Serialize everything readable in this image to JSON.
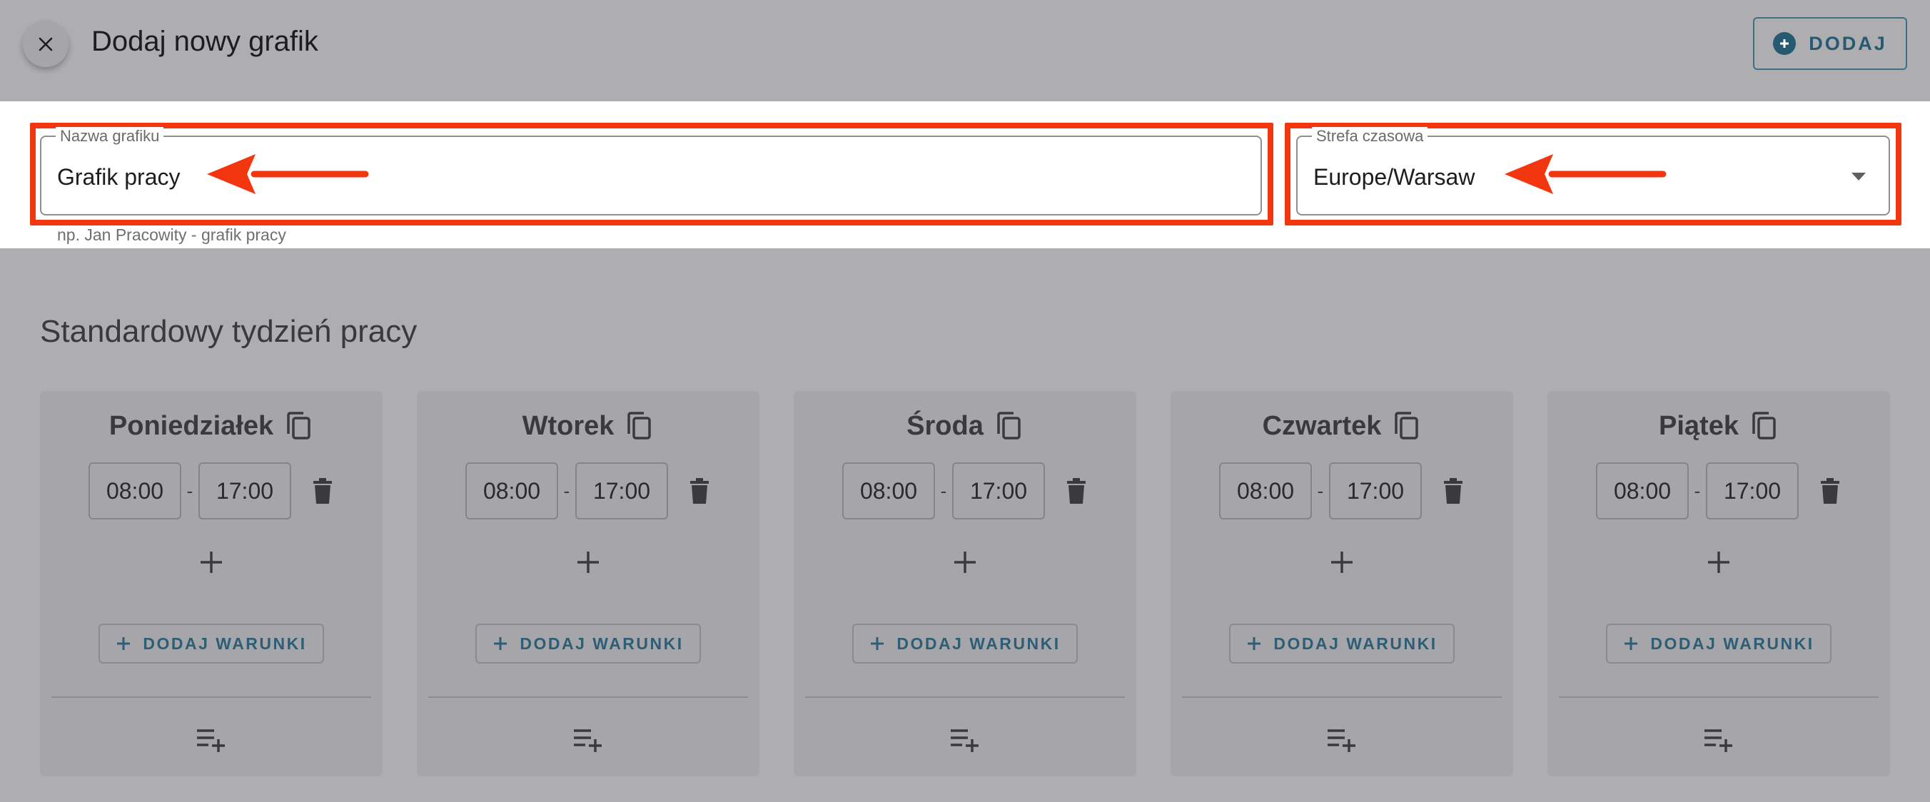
{
  "dialog": {
    "title": "Dodaj nowy grafik",
    "add_label": "DODAJ"
  },
  "form": {
    "name_label": "Nazwa grafiku",
    "name_value": "Grafik pracy",
    "name_helper": "np. Jan Pracowity - grafik pracy",
    "zone_label": "Strefa czasowa",
    "zone_value": "Europe/Warsaw"
  },
  "section": {
    "title": "Standardowy tydzień pracy"
  },
  "days": [
    {
      "name": "Poniedziałek",
      "start": "08:00",
      "end": "17:00",
      "sep": "-",
      "conditions_label": "DODAJ WARUNKI"
    },
    {
      "name": "Wtorek",
      "start": "08:00",
      "end": "17:00",
      "sep": "-",
      "conditions_label": "DODAJ WARUNKI"
    },
    {
      "name": "Środa",
      "start": "08:00",
      "end": "17:00",
      "sep": "-",
      "conditions_label": "DODAJ WARUNKI"
    },
    {
      "name": "Czwartek",
      "start": "08:00",
      "end": "17:00",
      "sep": "-",
      "conditions_label": "DODAJ WARUNKI"
    },
    {
      "name": "Piątek",
      "start": "08:00",
      "end": "17:00",
      "sep": "-",
      "conditions_label": "DODAJ WARUNKI"
    }
  ],
  "colors": {
    "highlight": "#f2360f",
    "accent": "#265a73",
    "overlay": "#aeadb0"
  },
  "icons": {
    "close": "close-icon",
    "add": "plus-circle-icon",
    "dropdown": "chevron-down-icon",
    "copy": "copy-icon",
    "trash": "trash-icon",
    "add_slot": "plus-icon",
    "playlist_add": "playlist-add-icon",
    "annotation": "arrow-left-icon"
  }
}
